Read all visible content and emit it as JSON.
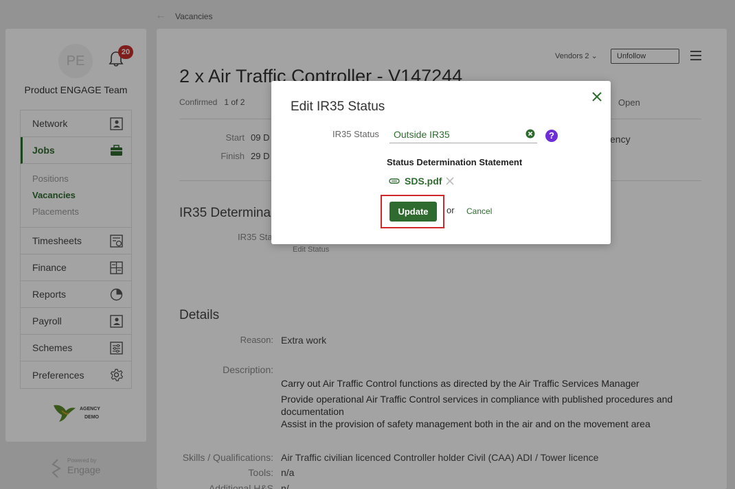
{
  "breadcrumb": {
    "back_icon": "arrow-left-icon",
    "label": "Vacancies"
  },
  "sidebar": {
    "avatar_initials": "PE",
    "notification_count": "20",
    "team_name": "Product ENGAGE Team",
    "items": [
      {
        "label": "Network",
        "icon": "contact-card-icon"
      },
      {
        "label": "Jobs",
        "icon": "briefcase-icon",
        "active": true
      },
      {
        "label": "Timesheets",
        "icon": "timesheet-icon"
      },
      {
        "label": "Finance",
        "icon": "calculator-icon"
      },
      {
        "label": "Reports",
        "icon": "pie-chart-icon"
      },
      {
        "label": "Payroll",
        "icon": "id-card-icon"
      },
      {
        "label": "Schemes",
        "icon": "sliders-icon"
      },
      {
        "label": "Preferences",
        "icon": "gear-icon"
      }
    ],
    "jobs_subitems": [
      {
        "label": "Positions",
        "active": false
      },
      {
        "label": "Vacancies",
        "active": true
      },
      {
        "label": "Placements",
        "active": false
      }
    ],
    "agency_logo_text_1": "AGENCY",
    "agency_logo_text_2": "DEMO",
    "powered_by": "Powered by",
    "powered_brand": "Engage"
  },
  "header": {
    "vendors": "Vendors 2",
    "unfollow": "Unfollow",
    "title": "2 x Air Traffic Controller - V147244",
    "confirmed_label": "Confirmed",
    "confirmed_value": "1 of 2",
    "status": "Open"
  },
  "dates": {
    "start_label": "Start",
    "start_value": "09 D",
    "finish_label": "Finish",
    "finish_value": "29 D",
    "agency_fragment": "ency"
  },
  "ir35_section": {
    "title": "IR35 Determina",
    "status_label": "IR35 Sta",
    "edit_link": "Edit Status"
  },
  "details": {
    "title": "Details",
    "reason_label": "Reason:",
    "reason_value": "Extra work",
    "description_label": "Description:",
    "description_lines": [
      "Carry out Air Traffic Control functions as directed by the Air Traffic Services Manager",
      "Provide operational Air Traffic Control services in compliance with published procedures and documentation",
      "Assist in the provision of safety management both in the air and on the movement area"
    ],
    "skills_label": "Skills / Qualifications:",
    "skills_value": "Air Traffic civilian licenced Controller holder Civil (CAA) ADI / Tower licence",
    "tools_label": "Tools:",
    "tools_value": "n/a",
    "additional_label": "Additional H&S",
    "additional_value": "n/"
  },
  "modal": {
    "title": "Edit IR35 Status",
    "ir35_label": "IR35 Status",
    "ir35_value": "Outside IR35",
    "help": "?",
    "sds_title": "Status Determination Statement",
    "sds_file": "SDS.pdf",
    "update": "Update",
    "or": "or",
    "cancel": "Cancel"
  }
}
